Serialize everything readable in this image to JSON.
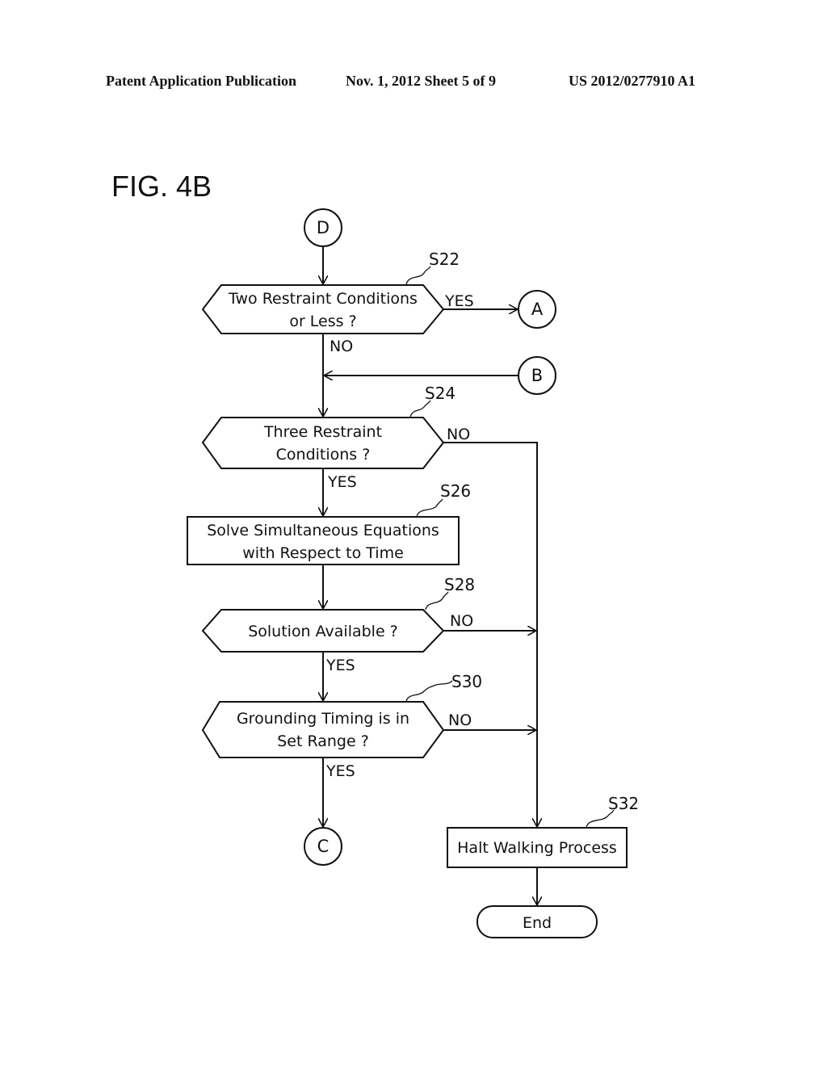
{
  "header": {
    "publication": "Patent Application Publication",
    "date_sheet": "Nov. 1, 2012    Sheet 5 of 9",
    "patent_number": "US 2012/0277910 A1"
  },
  "figure": {
    "title": "FIG. 4B"
  },
  "flowchart": {
    "connectors": {
      "start": "D",
      "yes_out": "A",
      "loop_in": "B",
      "exit": "C"
    },
    "nodes": [
      {
        "id": "S22",
        "type": "decision",
        "lines": [
          "Two Restraint Conditions",
          "or Less ?"
        ],
        "yes": "A",
        "no": "S24"
      },
      {
        "id": "S24",
        "type": "decision",
        "lines": [
          "Three Restraint",
          "Conditions ?"
        ],
        "yes": "S26",
        "no": "S32"
      },
      {
        "id": "S26",
        "type": "process",
        "lines": [
          "Solve Simultaneous Equations",
          "with Respect to Time"
        ],
        "next": "S28"
      },
      {
        "id": "S28",
        "type": "decision",
        "lines": [
          "Solution Available ?"
        ],
        "yes": "S30",
        "no": "S32"
      },
      {
        "id": "S30",
        "type": "decision",
        "lines": [
          "Grounding Timing is in",
          "Set Range ?"
        ],
        "yes": "C",
        "no": "S32"
      },
      {
        "id": "S32",
        "type": "process",
        "lines": [
          "Halt Walking Process"
        ],
        "next": "End"
      }
    ],
    "terminal": "End",
    "branch_labels": {
      "yes": "YES",
      "no": "NO"
    }
  }
}
